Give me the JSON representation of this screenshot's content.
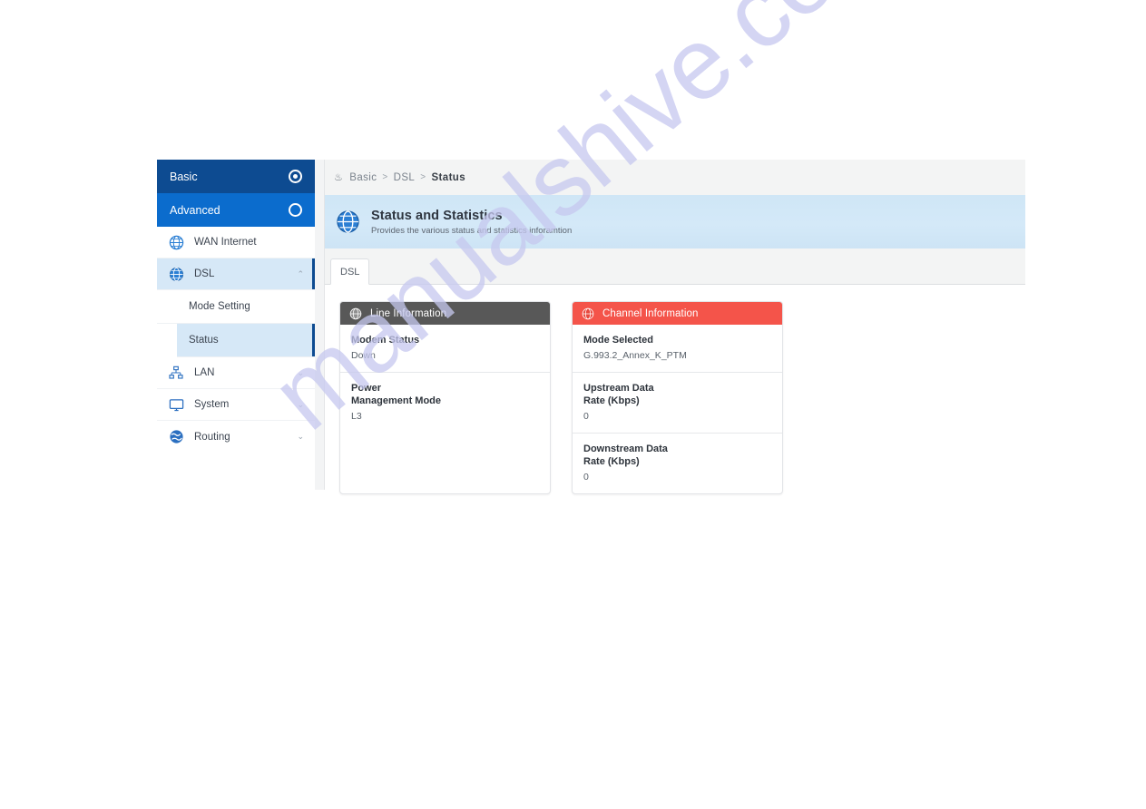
{
  "sidebar": {
    "headers": [
      {
        "label": "Basic",
        "icon": "radio-selected-icon"
      },
      {
        "label": "Advanced",
        "icon": "radio-empty-icon"
      }
    ],
    "items": [
      {
        "label": "WAN Internet",
        "icon": "globe-icon",
        "chevron": "",
        "active": false
      },
      {
        "label": "DSL",
        "icon": "globe-dsl-icon",
        "chevron": "⌃",
        "active": true
      },
      {
        "label": "LAN",
        "icon": "network-icon",
        "chevron": "⌄",
        "active": false
      },
      {
        "label": "System",
        "icon": "monitor-icon",
        "chevron": "⌄",
        "active": false
      },
      {
        "label": "Routing",
        "icon": "routing-globe-icon",
        "chevron": "⌄",
        "active": false
      }
    ],
    "sub_items": [
      {
        "label": "Mode Setting",
        "active": false
      },
      {
        "label": "Status",
        "active": true
      }
    ]
  },
  "breadcrumb": {
    "home_icon": "home-icon",
    "level1": "Basic",
    "level2": "DSL",
    "current": "Status",
    "separator": ">"
  },
  "banner": {
    "icon": "globe-icon",
    "title": "Status and Statistics",
    "subtitle": "Provides the various status and statistics inforamtion"
  },
  "tabs": [
    {
      "label": "DSL",
      "active": true
    }
  ],
  "cards": [
    {
      "title": "Line Information",
      "icon": "globe-icon",
      "header_color": "#585858",
      "rows": [
        {
          "key": "Modem Status",
          "value": "Down"
        },
        {
          "key": "Power Management Mode",
          "value": "L3"
        }
      ]
    },
    {
      "title": "Channel Information",
      "icon": "globe-icon",
      "header_color": "#f4544a",
      "rows": [
        {
          "key": "Mode Selected",
          "value": "G.993.2_Annex_K_PTM"
        },
        {
          "key": "Upstream Data Rate (Kbps)",
          "value": "0"
        },
        {
          "key": "Downstream Data Rate (Kbps)",
          "value": "0"
        }
      ]
    }
  ],
  "watermark": {
    "text": "manualshive.com"
  },
  "colors": {
    "basic_header": "#0d4b91",
    "advanced_header": "#0b6ccd",
    "active_row": "#d6e8f7",
    "accent_bar": "#0d4b91",
    "banner_bg": "#d1e7f7",
    "card_gray": "#585858",
    "card_red": "#f4544a"
  }
}
